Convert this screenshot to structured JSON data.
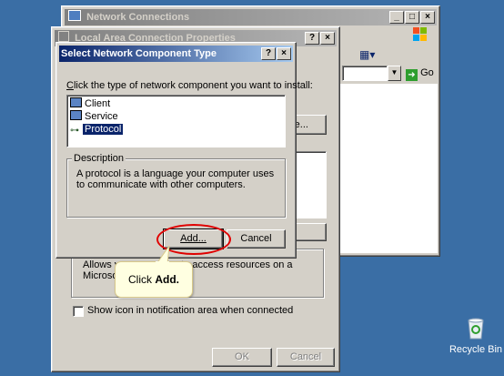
{
  "network_window": {
    "title": "Network Connections",
    "go_label": "Go"
  },
  "lac_window": {
    "title": "Local Area Connection Properties",
    "partial_button": "re...",
    "desc_text": "Allows your computer to access resources on a Microsoft network.",
    "show_icon_label": "Show icon in notification area when connected",
    "ok_label": "OK",
    "cancel_label": "Cancel"
  },
  "dialog": {
    "title": "Select Network Component Type",
    "instruction": "Click the type of network component you want to install:",
    "components": [
      {
        "label": "Client",
        "icon": "client-icon"
      },
      {
        "label": "Service",
        "icon": "service-icon"
      },
      {
        "label": "Protocol",
        "icon": "protocol-icon"
      }
    ],
    "selected_index": 2,
    "description_heading": "Description",
    "description_text": "A protocol is a language your computer uses to communicate with other computers.",
    "add_label": "Add...",
    "cancel_label": "Cancel"
  },
  "callout": {
    "prefix": "Click ",
    "emphasis": "Add."
  },
  "desktop": {
    "recycle_bin_label": "Recycle Bin"
  },
  "colors": {
    "desktop": "#3a6ea5",
    "title_active": "#0a246a",
    "selection": "#0a246a",
    "callout_bg": "#ffffe1",
    "highlight_ring": "#e00000"
  }
}
